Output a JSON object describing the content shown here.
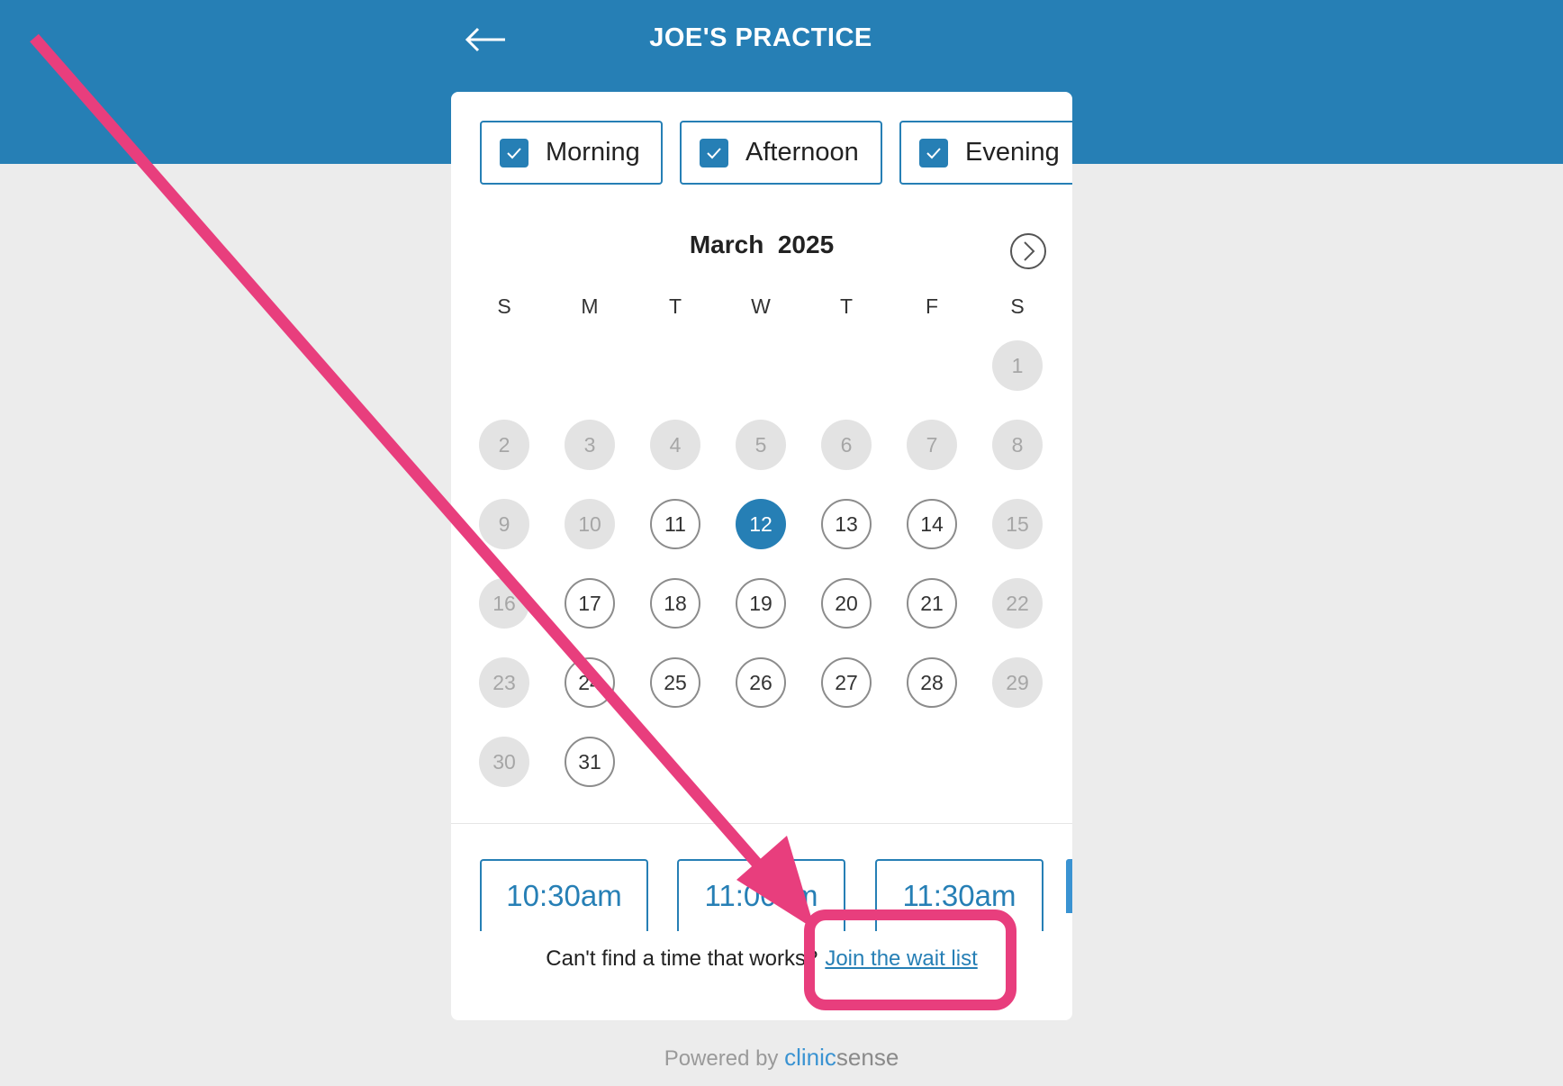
{
  "header": {
    "back_icon": "arrow-left-icon",
    "title": "JOE'S PRACTICE"
  },
  "filters": [
    {
      "label": "Morning",
      "checked": true
    },
    {
      "label": "Afternoon",
      "checked": true
    },
    {
      "label": "Evening",
      "checked": true
    }
  ],
  "calendar": {
    "month_title": "March  2025",
    "next_icon": "chevron-right-icon",
    "weekdays": [
      "S",
      "M",
      "T",
      "W",
      "T",
      "F",
      "S"
    ],
    "first_weekday_index": 6,
    "selected_day": 12,
    "days": [
      {
        "d": "1",
        "state": "unavailable"
      },
      {
        "d": "2",
        "state": "unavailable"
      },
      {
        "d": "3",
        "state": "unavailable"
      },
      {
        "d": "4",
        "state": "unavailable"
      },
      {
        "d": "5",
        "state": "unavailable"
      },
      {
        "d": "6",
        "state": "unavailable"
      },
      {
        "d": "7",
        "state": "unavailable"
      },
      {
        "d": "8",
        "state": "unavailable"
      },
      {
        "d": "9",
        "state": "unavailable"
      },
      {
        "d": "10",
        "state": "unavailable"
      },
      {
        "d": "11",
        "state": "available"
      },
      {
        "d": "12",
        "state": "selected"
      },
      {
        "d": "13",
        "state": "available"
      },
      {
        "d": "14",
        "state": "available"
      },
      {
        "d": "15",
        "state": "unavailable"
      },
      {
        "d": "16",
        "state": "unavailable"
      },
      {
        "d": "17",
        "state": "available"
      },
      {
        "d": "18",
        "state": "available"
      },
      {
        "d": "19",
        "state": "available"
      },
      {
        "d": "20",
        "state": "available"
      },
      {
        "d": "21",
        "state": "available"
      },
      {
        "d": "22",
        "state": "unavailable"
      },
      {
        "d": "23",
        "state": "unavailable"
      },
      {
        "d": "24",
        "state": "available"
      },
      {
        "d": "25",
        "state": "available"
      },
      {
        "d": "26",
        "state": "available"
      },
      {
        "d": "27",
        "state": "available"
      },
      {
        "d": "28",
        "state": "available"
      },
      {
        "d": "29",
        "state": "unavailable"
      },
      {
        "d": "30",
        "state": "unavailable"
      },
      {
        "d": "31",
        "state": "available"
      }
    ]
  },
  "time_slots": [
    "10:30am",
    "11:00am",
    "11:30am"
  ],
  "waitlist": {
    "prompt": "Can't find a time that works?",
    "link": "Join the wait list"
  },
  "footer": {
    "powered_by": "Powered by",
    "brand_part1": "clinic",
    "brand_part2": "sense"
  },
  "colors": {
    "primary": "#267fb5",
    "background": "#ececec",
    "annotation": "#e83e7d"
  }
}
